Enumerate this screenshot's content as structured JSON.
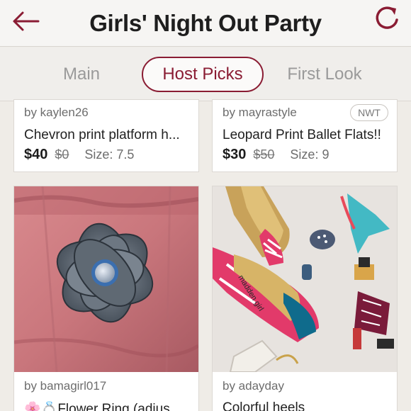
{
  "header": {
    "title": "Girls' Night Out Party",
    "back_icon": "back-arrow-icon",
    "refresh_icon": "refresh-icon",
    "accent_color": "#8a1c33"
  },
  "tabs": [
    {
      "label": "Main",
      "active": false
    },
    {
      "label": "Host Picks",
      "active": true
    },
    {
      "label": "First Look",
      "active": false
    }
  ],
  "listings": [
    {
      "seller": "by kaylen26",
      "title": "Chevron print platform h...",
      "price": "$40",
      "original_price": "$0",
      "size": "Size: 7.5"
    },
    {
      "seller": "by mayrastyle",
      "badge": "NWT",
      "title": "Leopard Print Ballet Flats!!",
      "price": "$30",
      "original_price": "$50",
      "size": "Size: 9"
    },
    {
      "seller": "by bamagirl017",
      "title": "🌸💍Flower Ring (adjus..."
    },
    {
      "seller": "by adayday",
      "title": "Colorful heels"
    }
  ]
}
